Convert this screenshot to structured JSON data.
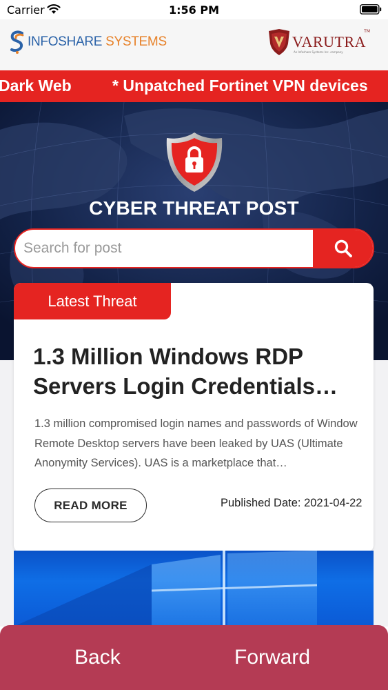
{
  "status_bar": {
    "carrier": "Carrier",
    "time": "1:56 PM"
  },
  "header": {
    "infoshare_logo": {
      "part1": "INFOSHARE",
      "part2": " SYSTEMS"
    },
    "varutra_logo": {
      "name": "VARUTRA",
      "tm": "TM",
      "tagline": "An Infoshare Systems Inc. company"
    }
  },
  "ticker": {
    "items": [
      "Dark Web",
      "* Unpatched Fortinet VPN devices"
    ]
  },
  "hero": {
    "title": "CYBER THREAT POST"
  },
  "search": {
    "placeholder": "Search for post"
  },
  "card": {
    "tab_label": "Latest Threat",
    "title": "1.3 Million Windows RDP Servers Login Credentials…",
    "excerpt": "1.3 million compromised login names and passwords of Window Remote Desktop servers have been leaked by UAS (Ultimate Anonymity Services). UAS is a marketplace that…",
    "read_more": "READ MORE",
    "published": "Published Date: 2021-04-22"
  },
  "bottom_nav": {
    "back": "Back",
    "forward": "Forward"
  },
  "colors": {
    "accent_red": "#e52421",
    "nav_bg": "#b43b54",
    "hero_bg": "#0f1c3d"
  }
}
